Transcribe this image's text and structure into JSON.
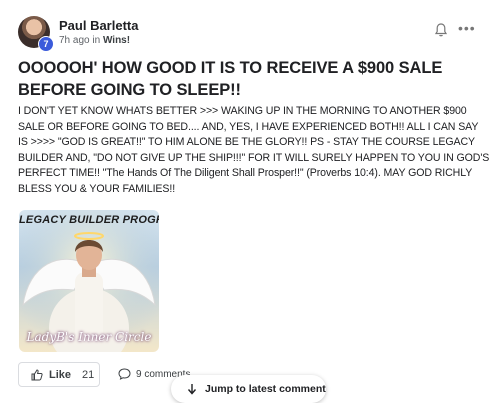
{
  "post": {
    "author": "Paul Barletta",
    "author_level": "7",
    "time_ago": "7h ago in",
    "category": "Wins!",
    "title": "OOOOOH' HOW GOOD IT IS TO RECEIVE A $900 SALE BEFORE GOING TO SLEEP!!",
    "body": "I DON'T YET KNOW WHATS BETTER >>> WAKING UP IN THE MORNING TO ANOTHER $900 SALE OR BEFORE GOING TO BED.... AND, YES, I HAVE EXPERIENCED BOTH!! ALL I CAN SAY IS >>>> \"GOD IS GREAT!!\" TO HIM ALONE BE THE GLORY!! PS - STAY THE COURSE LEGACY BUILDER AND, \"DO NOT GIVE UP THE SHIP!!!\" FOR IT WILL SURELY HAPPEN TO YOU IN GOD'S PERFECT TIME!! \"The Hands Of The Diligent Shall Prosper!!\" (Proverbs 10:4). MAY GOD RICHLY BLESS YOU & YOUR FAMILIES!!",
    "image": {
      "caption_top": "LEGACY BUILDER PROGRAM",
      "caption_bottom": "LadyB's Inner Circle"
    }
  },
  "actions": {
    "like_label": "Like",
    "like_count": "21",
    "comments_label": "9 comments"
  },
  "jump_button": {
    "label": "Jump to latest comment"
  },
  "icons": {
    "bell": "bell-icon",
    "more": "more-icon",
    "like": "thumbs-up-icon",
    "comment": "comment-icon",
    "jump": "arrow-down-icon"
  },
  "colors": {
    "level_badge": "#3b5bdb",
    "text": "#202124",
    "muted": "#5f6368"
  }
}
